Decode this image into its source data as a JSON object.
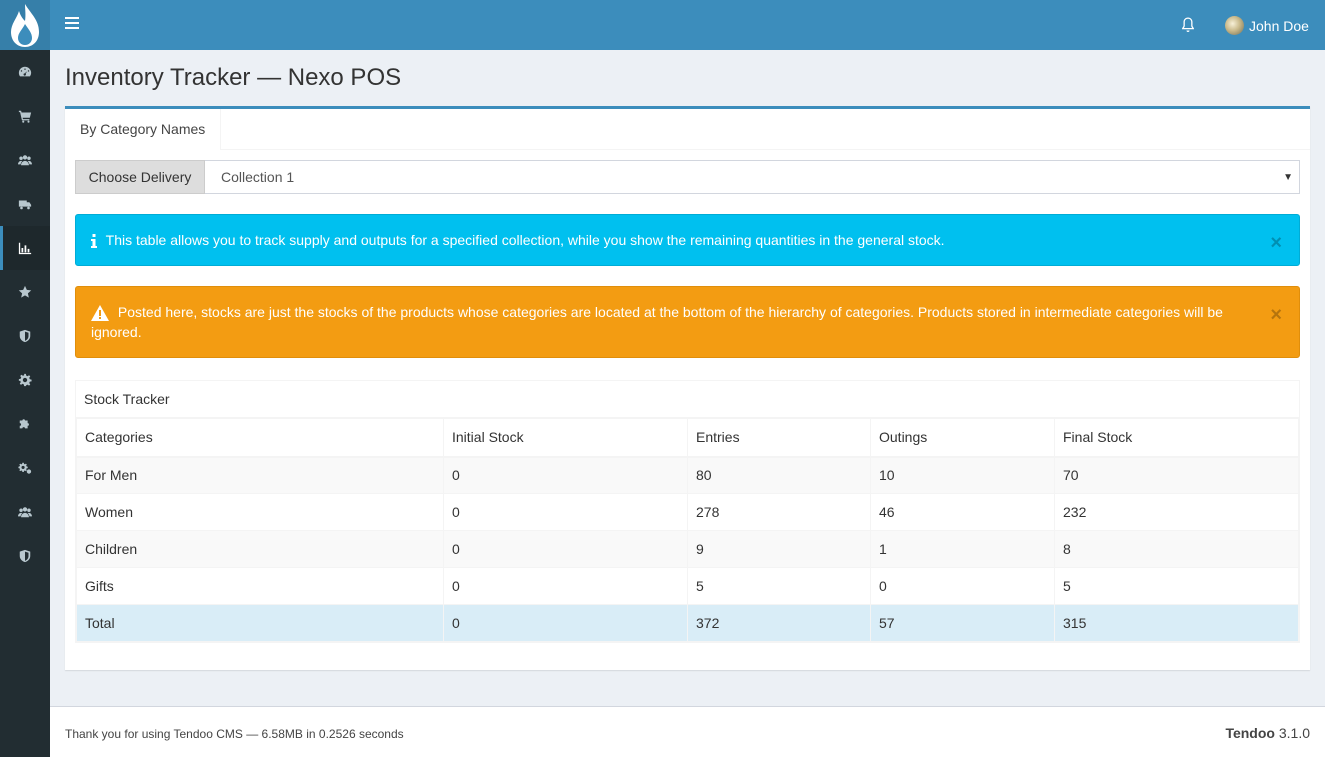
{
  "header": {
    "user_name": "John Doe"
  },
  "page": {
    "title": "Inventory Tracker — Nexo POS"
  },
  "tabs": [
    {
      "label": "By Category Names"
    }
  ],
  "delivery": {
    "button_label": "Choose Delivery",
    "selected": "Collection 1"
  },
  "alerts": {
    "info": "This table allows you to track supply and outputs for a specified collection, while you show the remaining quantities in the general stock.",
    "warning": "Posted here, stocks are just the stocks of the products whose categories are located at the bottom of the hierarchy of categories. Products stored in intermediate categories will be ignored.",
    "close": "×"
  },
  "table": {
    "title": "Stock Tracker",
    "headers": [
      "Categories",
      "Initial Stock",
      "Entries",
      "Outings",
      "Final Stock"
    ],
    "rows": [
      [
        "For Men",
        "0",
        "80",
        "10",
        "70"
      ],
      [
        "Women",
        "0",
        "278",
        "46",
        "232"
      ],
      [
        "Children",
        "0",
        "9",
        "1",
        "8"
      ],
      [
        "Gifts",
        "0",
        "5",
        "0",
        "5"
      ]
    ],
    "total": [
      "Total",
      "0",
      "372",
      "57",
      "315"
    ]
  },
  "footer": {
    "left": "Thank you for using Tendoo CMS — 6.58MB in 0.2526 seconds",
    "brand": "Tendoo",
    "version": "3.1.0"
  },
  "sidebar_icons": [
    "dashboard-icon",
    "cart-icon",
    "users-icon",
    "truck-icon",
    "bar-chart-icon",
    "star-icon",
    "shield-icon",
    "gear-icon",
    "puzzle-icon",
    "gears-icon",
    "group-icon",
    "shield-icon-2"
  ],
  "colors": {
    "header": "#3c8dbc",
    "sidebar": "#222d32",
    "info": "#00c0ef",
    "warning": "#f39c12",
    "total_row": "#d9edf7"
  }
}
